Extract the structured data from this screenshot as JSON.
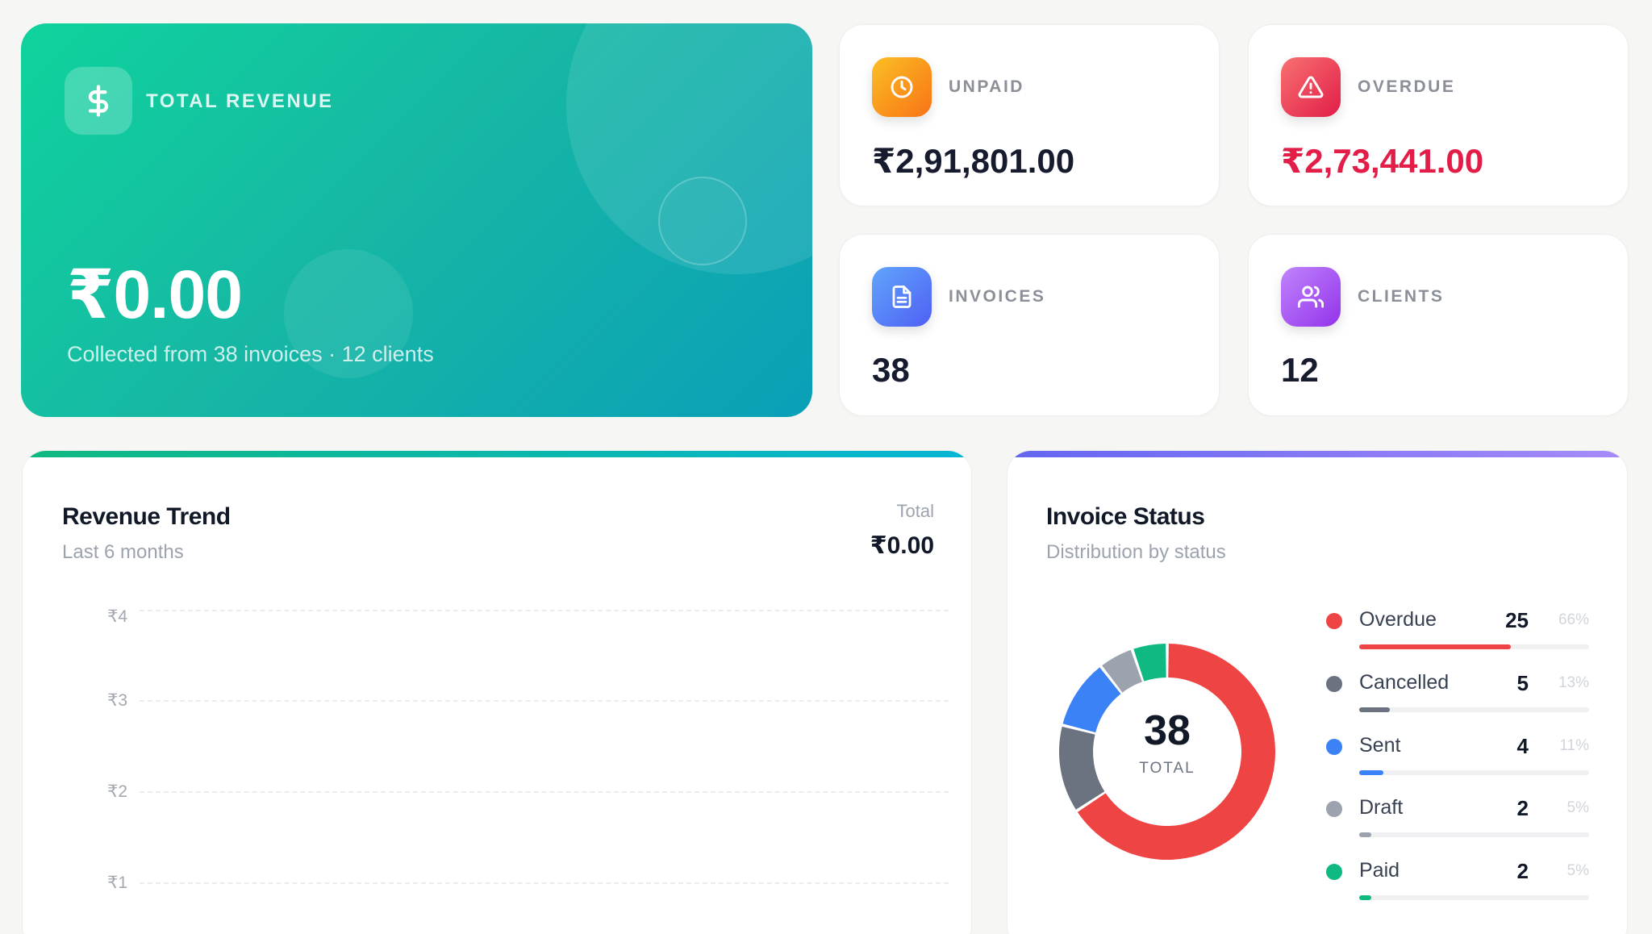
{
  "revenue": {
    "label": "TOTAL REVENUE",
    "amount": "₹0.00",
    "sub": "Collected from 38 invoices · 12 clients",
    "icon": "dollar-icon"
  },
  "stats": {
    "unpaid": {
      "label": "UNPAID",
      "value": "₹2,91,801.00",
      "icon": "clock-icon",
      "color": "#f97316"
    },
    "overdue": {
      "label": "OVERDUE",
      "value": "₹2,73,441.00",
      "icon": "alert-triangle-icon",
      "color": "#ef4444",
      "value_color": "#e11d48"
    },
    "invoices": {
      "label": "INVOICES",
      "value": "38",
      "icon": "document-icon",
      "color": "#4f7cf7"
    },
    "clients": {
      "label": "CLIENTS",
      "value": "12",
      "icon": "users-icon",
      "color": "#a855f7"
    }
  },
  "trend": {
    "title": "Revenue Trend",
    "subtitle": "Last 6 months",
    "total_label": "Total",
    "total_value": "₹0.00",
    "y_ticks": [
      "₹4",
      "₹3",
      "₹2",
      "₹1"
    ]
  },
  "status": {
    "title": "Invoice Status",
    "subtitle": "Distribution by status",
    "center_value": "38",
    "center_label": "TOTAL",
    "items": [
      {
        "name": "Overdue",
        "count": 25,
        "pct": "66%",
        "color": "#ef4444"
      },
      {
        "name": "Cancelled",
        "count": 5,
        "pct": "13%",
        "color": "#6b7280"
      },
      {
        "name": "Sent",
        "count": 4,
        "pct": "11%",
        "color": "#3b82f6"
      },
      {
        "name": "Draft",
        "count": 2,
        "pct": "5%",
        "color": "#9ca3af"
      },
      {
        "name": "Paid",
        "count": 2,
        "pct": "5%",
        "color": "#10b981"
      }
    ]
  }
}
